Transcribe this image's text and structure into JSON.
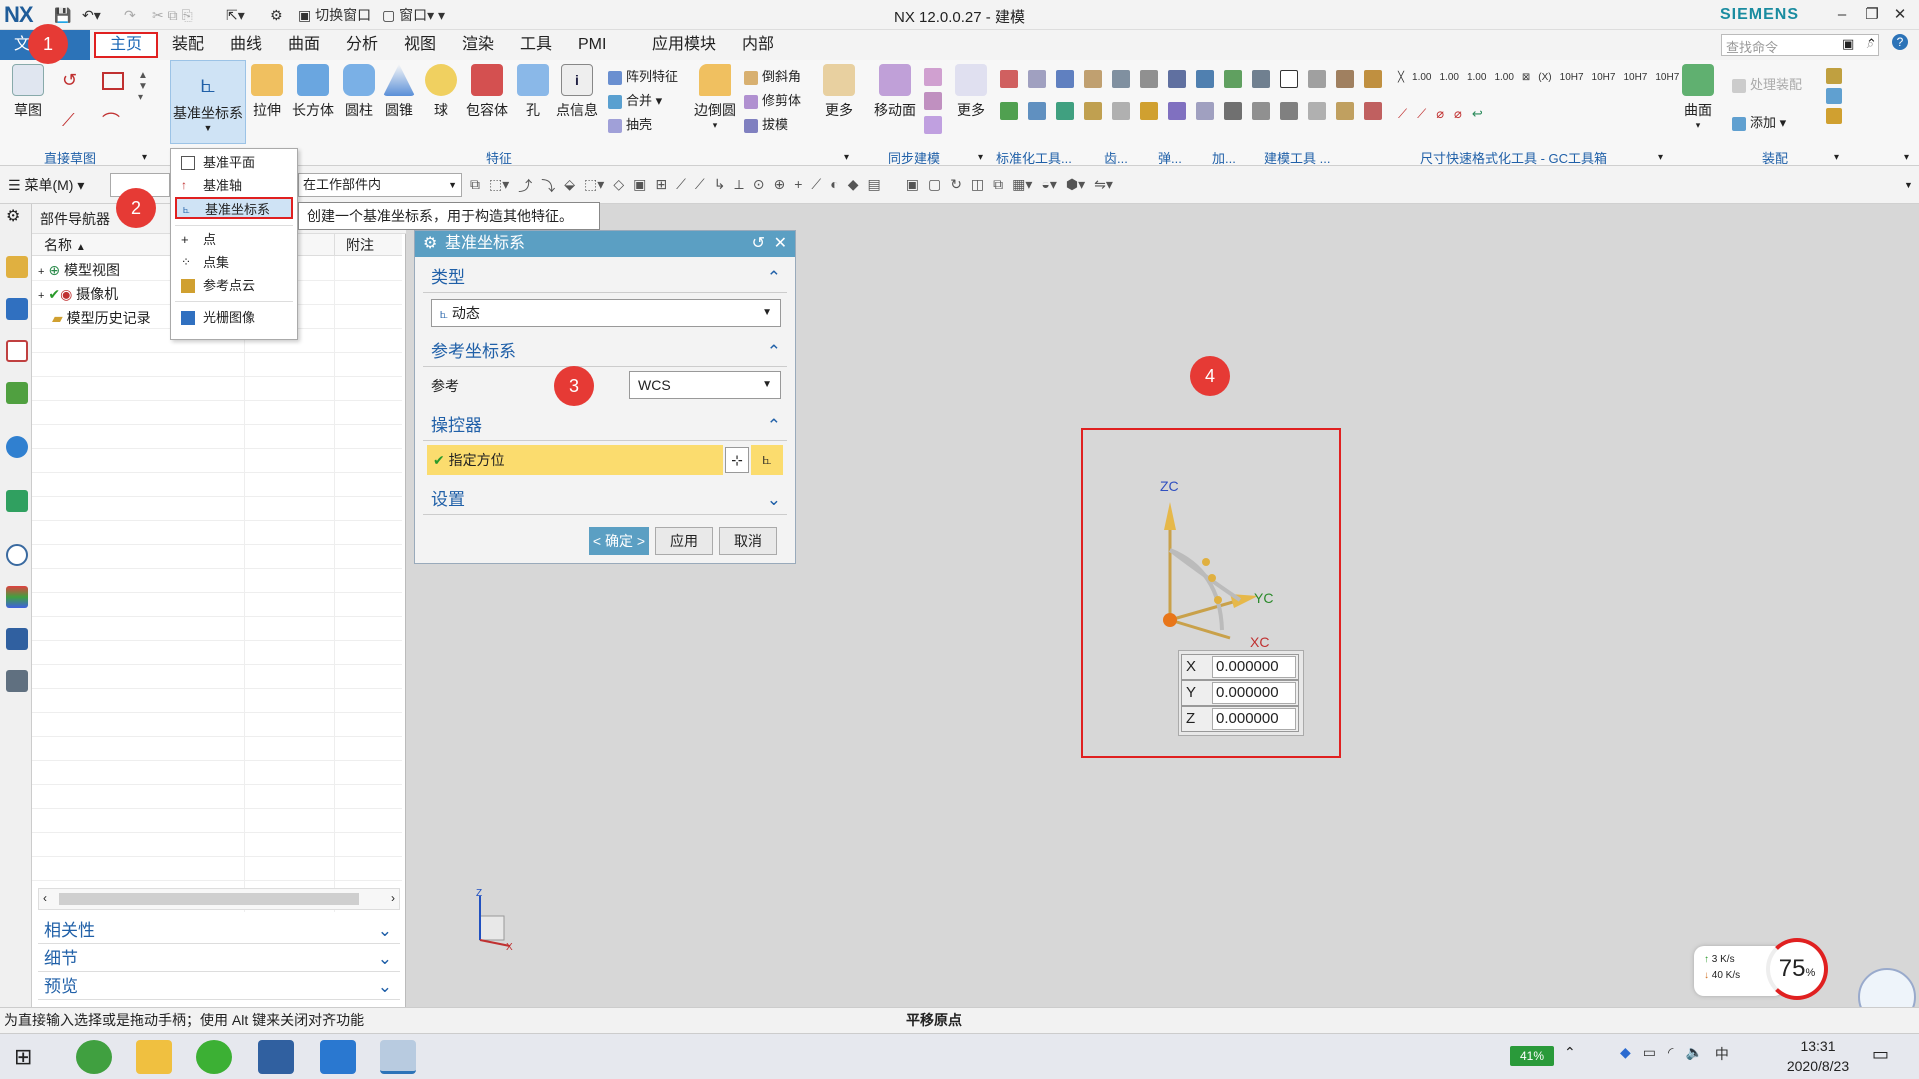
{
  "window": {
    "app_logo": "NX",
    "title": "NX 12.0.0.27 - 建模",
    "brand": "SIEMENS",
    "quick_access": {
      "switch_window": "切换窗口",
      "window": "窗口"
    }
  },
  "tabs": {
    "file": "文件",
    "items": [
      "主页",
      "装配",
      "曲线",
      "曲面",
      "分析",
      "视图",
      "渲染",
      "工具",
      "PMI",
      "应用模块",
      "内部"
    ]
  },
  "search": {
    "placeholder": "查找命令"
  },
  "ribbon": {
    "sketch": "草图",
    "direct_sketch_group": "直接草图",
    "datum_csys": "基准坐标系",
    "extrude": "拉伸",
    "block": "长方体",
    "cylinder": "圆柱",
    "cone": "圆锥",
    "sphere": "球",
    "bounding_body": "包容体",
    "hole": "孔",
    "point_info": "点信息",
    "pattern": "阵列特征",
    "unite": "合并",
    "shell": "抽壳",
    "edge_blend": "边倒圆",
    "chamfer": "倒斜角",
    "trim_body": "修剪体",
    "draft": "拔模",
    "more1": "更多",
    "feature_group": "特征",
    "move_face": "移动面",
    "more2": "更多",
    "sync_group": "同步建模",
    "std_tools_group": "标准化工具...",
    "gear_group": "齿...",
    "spring_group": "弹...",
    "add_group": "加...",
    "modeling_tools_group": "建模工具 ...",
    "dim_group": "尺寸快速格式化工具 - GC工具箱",
    "surface": "曲面",
    "process_assembly": "处理装配",
    "add": "添加",
    "assembly_group": "装配"
  },
  "toolbar2": {
    "menu": "菜单(M)",
    "scope": "在工作部件内"
  },
  "navigator": {
    "title": "部件导航器",
    "col_name": "名称",
    "col_note": "附注",
    "items": [
      "模型视图",
      "摄像机",
      "模型历史记录"
    ],
    "panels": [
      "相关性",
      "细节",
      "预览"
    ]
  },
  "dropdown": {
    "items": [
      "基准平面",
      "基准轴",
      "基准坐标系",
      "点",
      "点集",
      "参考点云",
      "光栅图像"
    ],
    "tooltip": "创建一个基准坐标系，用于构造其他特征。"
  },
  "dialog": {
    "title": "基准坐标系",
    "type_section": "类型",
    "type_value": "动态",
    "ref_section": "参考坐标系",
    "ref_label": "参考",
    "ref_value": "WCS",
    "manip_section": "操控器",
    "specify_orient": "指定方位",
    "settings_section": "设置",
    "ok": "< 确定 >",
    "apply": "应用",
    "cancel": "取消"
  },
  "badges": [
    "1",
    "2",
    "3",
    "4"
  ],
  "viewport": {
    "axes": {
      "z": "ZC",
      "y": "YC",
      "x": "XC"
    },
    "coords": [
      {
        "label": "X",
        "value": "0.000000"
      },
      {
        "label": "Y",
        "value": "0.000000"
      },
      {
        "label": "Z",
        "value": "0.000000"
      }
    ],
    "triad": {
      "z": "Z",
      "x": "X"
    },
    "net": {
      "up": "3 K/s",
      "down": "40 K/s",
      "percent": "75",
      "percent_unit": "%"
    }
  },
  "status": {
    "left": "为直接输入选择或是拖动手柄；使用 Alt 键来关闭对齐功能",
    "center": "平移原点"
  },
  "taskbar": {
    "battery": "41%",
    "time": "13:31",
    "date": "2020/8/23"
  },
  "colors": {
    "accent": "#2c73b8",
    "badge": "#e63a35",
    "dialog_header": "#5b9fc3",
    "highlight": "#fbdc6e"
  }
}
